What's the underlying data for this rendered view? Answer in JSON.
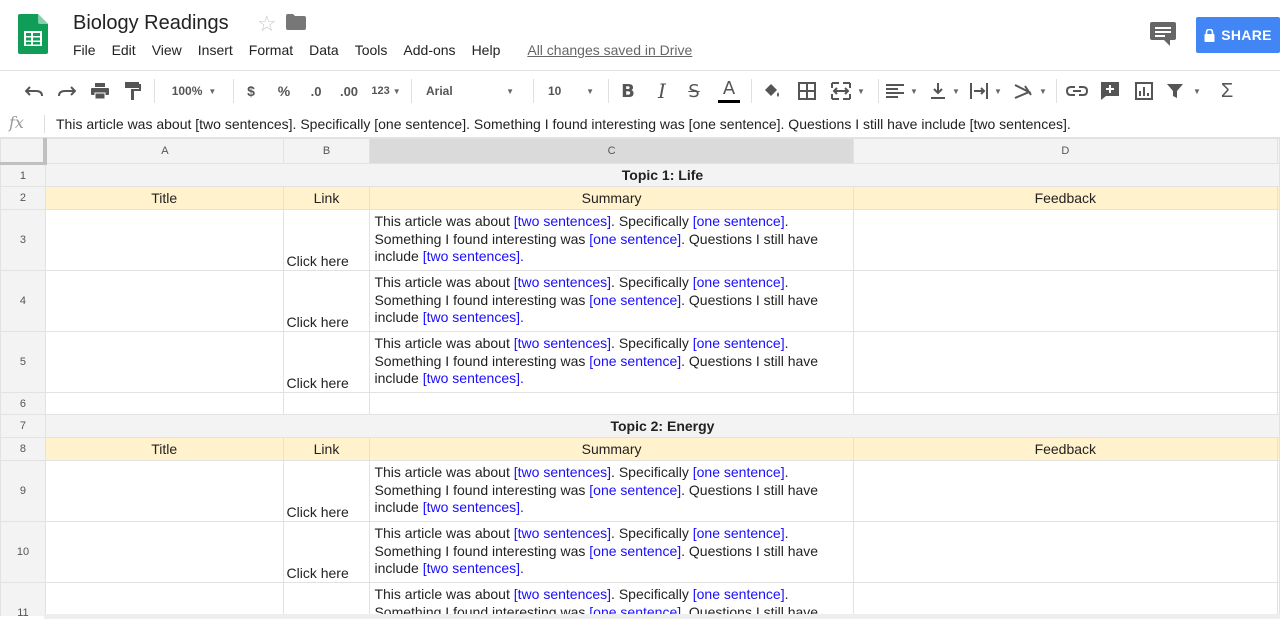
{
  "app": {
    "title": "Biology Readings",
    "menu": [
      "File",
      "Edit",
      "View",
      "Insert",
      "Format",
      "Data",
      "Tools",
      "Add-ons",
      "Help"
    ],
    "saved_status": "All changes saved in Drive",
    "share_label": "SHARE",
    "brand_color": "#0f9d58",
    "share_color": "#4285f4"
  },
  "toolbar": {
    "zoom": "100%",
    "currency": "$",
    "percent": "%",
    "decrease_decimal": ".0",
    "increase_decimal": ".00",
    "more_formats": "123",
    "font": "Arial",
    "font_size": "10",
    "bold": "B",
    "italic": "I",
    "strike": "S",
    "text_color_letter": "A"
  },
  "formula_bar": {
    "label": "fx",
    "content": "This article was about [two sentences]. Specifically [one sentence]. Something I found interesting was [one sentence]. Questions I still have include [two sentences]."
  },
  "sheet": {
    "columns": [
      "A",
      "B",
      "C",
      "D"
    ],
    "header_fill": "#fff2cc",
    "headers": {
      "title": "Title",
      "link": "Link",
      "summary": "Summary",
      "feedback": "Feedback"
    },
    "link_text": "Click here",
    "summary": {
      "p1": "This article was about ",
      "b1": "[two sentences]",
      "p2": ". Specifically ",
      "b2": "[one sentence]",
      "p3": ". Something I found interesting was ",
      "b3": "[one sentence]",
      "p4": ". Questions I still have include ",
      "b4": "[two sentences]",
      "p5": "."
    },
    "row_numbers": [
      "1",
      "2",
      "3",
      "4",
      "5",
      "6",
      "7",
      "8",
      "9",
      "10",
      "11"
    ],
    "topics": [
      "Topic 1: Life",
      "Topic 2: Energy"
    ]
  }
}
